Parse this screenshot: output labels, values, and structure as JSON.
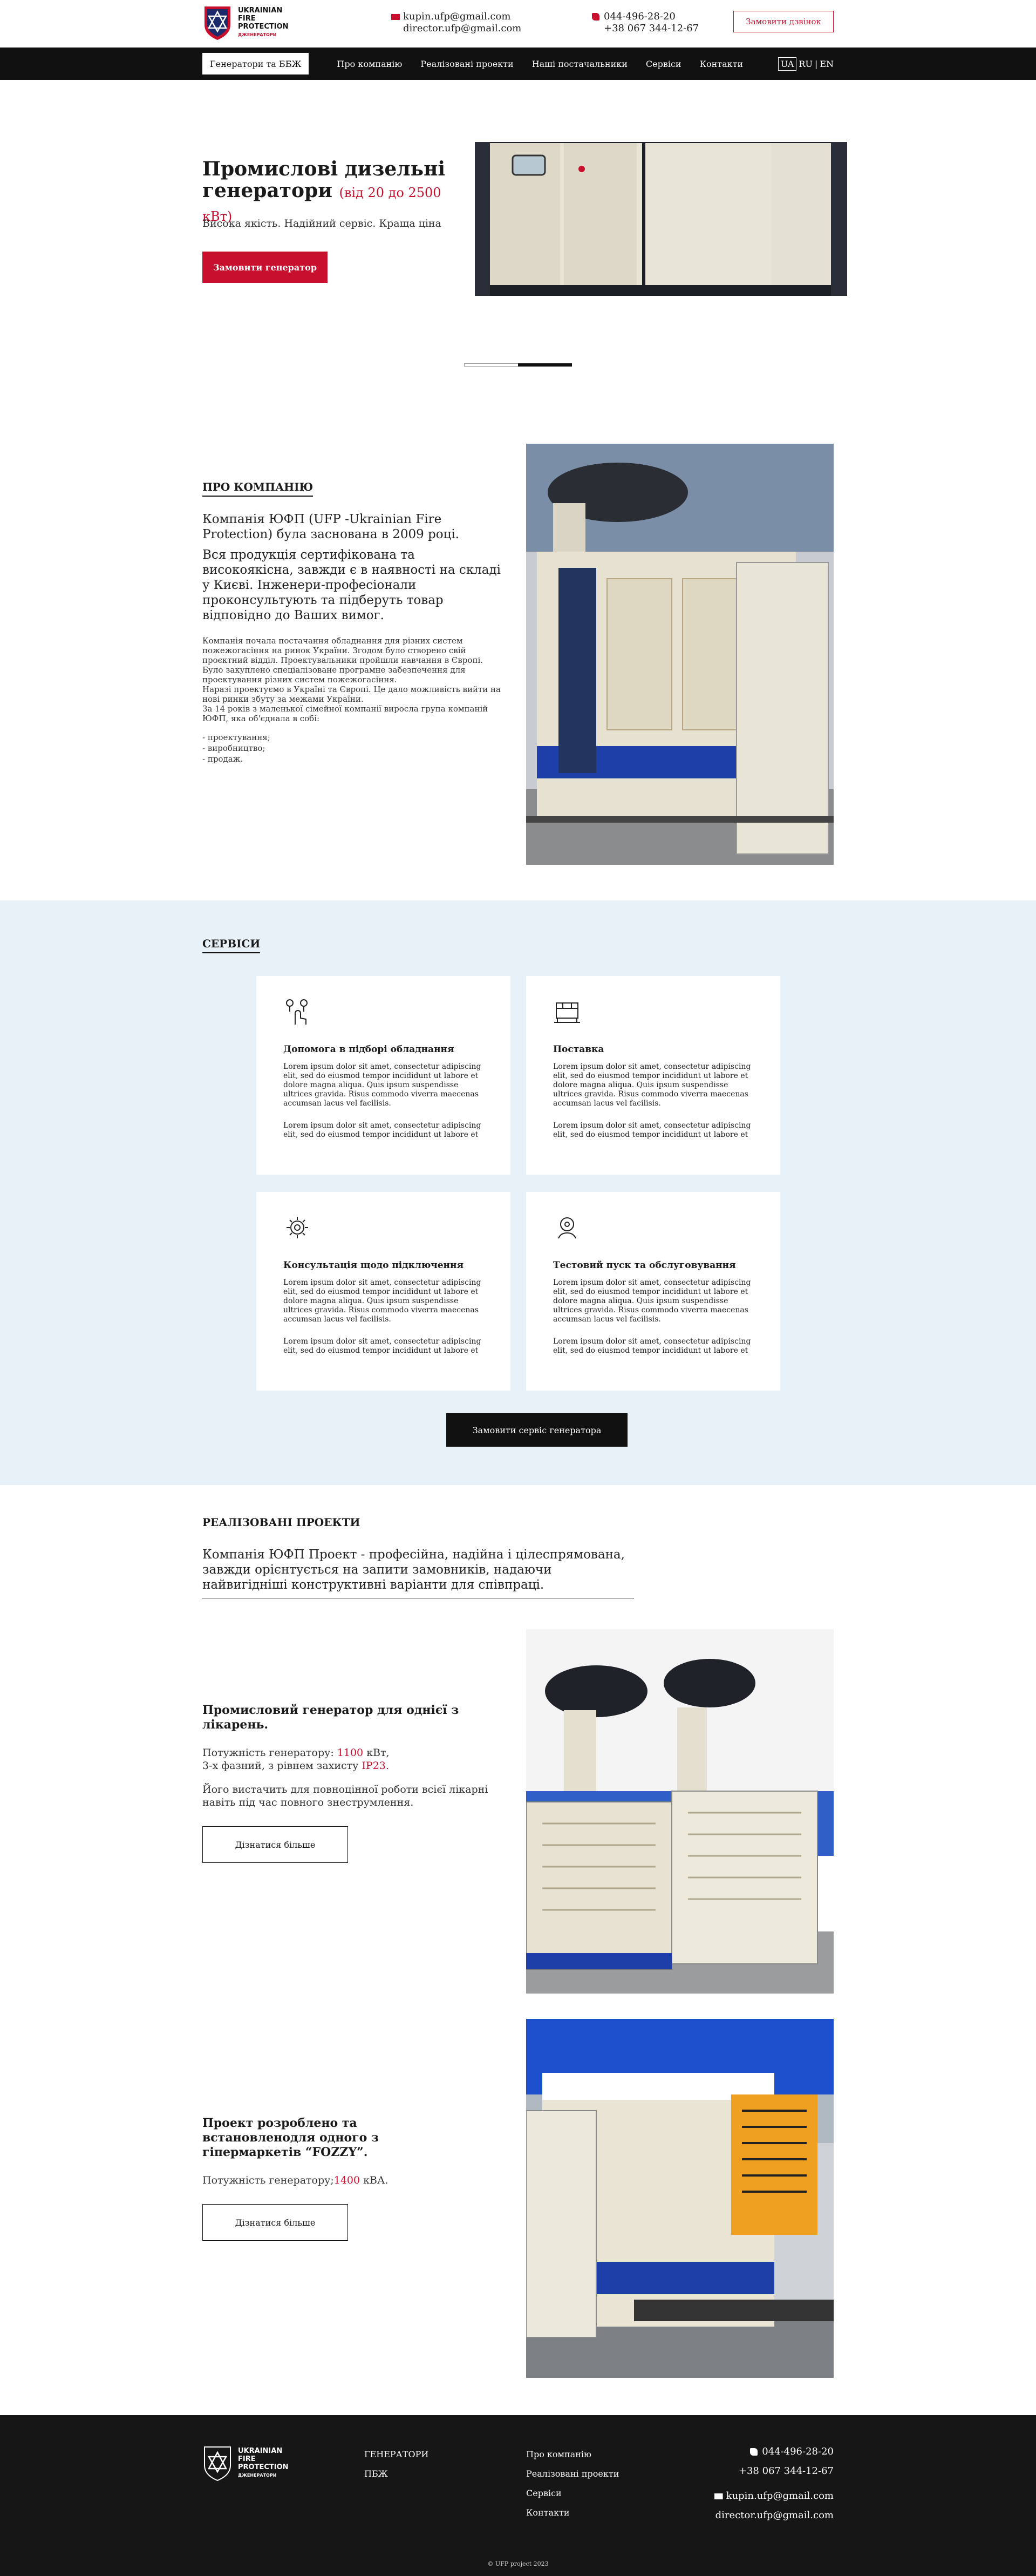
{
  "brand": {
    "name_line1": "UKRAINIAN",
    "name_line2": "FIRE",
    "name_line3": "PROTECTION",
    "name_sub": "ДЖЕНЕРАТОРИ"
  },
  "header": {
    "email1": "kupin.ufp@gmail.com",
    "email2": "director.ufp@gmail.com",
    "phone1": "044-496-28-20",
    "phone2": "+38 067 344-12-67",
    "call_button": "Замовити дзвінок"
  },
  "nav": {
    "active": "Генератори та ББЖ",
    "items": [
      "Про компанію",
      "Реалізовані проекти",
      "Наші постачальники",
      "Сервіси",
      "Контакти"
    ],
    "langs": [
      "UA",
      "RU",
      "EN"
    ],
    "lang_sep": "|"
  },
  "hero": {
    "title": "Промислові дизельні генератори",
    "range": "(від 20 до 2500 кВт)",
    "subtitle": "Висока якість. Надійний сервіс. Краща ціна",
    "cta": "Замовити генератор",
    "slide_position": 0.5
  },
  "about": {
    "label": "Про компанію",
    "lead": "Компанія ЮФП (UFP -Ukrainian Fire Protection) була заснована в 2009 році.",
    "lead2": "Вся продукція сертифікована та високоякісна, завжди є в наявності на складі у Києві. Інженери-професіонали проконсультують та підберуть товар відповідно до Ваших вимог.",
    "body": [
      "Компанія почала постачання обладнання для різних систем пожежогасіння на ринок України. Згодом було створено свій проєктний відділ. Проектувальники пройшли навчання в Європі. Було закуплено спеціалізоване програмне забезпечення для проектування різних систем пожежогасіння.",
      "Наразі проектуємо в Україні та Європі. Це дало можливість вийти на нові ринки збуту за межами України.",
      "За 14 років з маленької сімейної компанії виросла група компаній ЮФП, яка об'єднала в собі:"
    ],
    "list": [
      "- проектування;",
      "- виробництво;",
      "- продаж."
    ]
  },
  "services": {
    "label": "Сервіси",
    "cards": [
      {
        "title": "Допомога в підборі обладнання",
        "icon": "hand-selection-icon",
        "p1": "Lorem ipsum dolor sit amet, consectetur adipiscing elit, sed do eiusmod tempor incididunt ut labore et dolore magna aliqua. Quis ipsum suspendisse ultrices gravida. Risus commodo viverra maecenas accumsan lacus vel facilisis.",
        "p2": "Lorem ipsum dolor sit amet, consectetur adipiscing elit, sed do eiusmod tempor incididunt ut labore et"
      },
      {
        "title": "Поставка",
        "icon": "delivery-box-icon",
        "p1": "Lorem ipsum dolor sit amet, consectetur adipiscing elit, sed do eiusmod tempor incididunt ut labore et dolore magna aliqua. Quis ipsum suspendisse ultrices gravida. Risus commodo viverra maecenas accumsan lacus vel facilisis.",
        "p2": "Lorem ipsum dolor sit amet, consectetur adipiscing elit, sed do eiusmod tempor incididunt ut labore et"
      },
      {
        "title": "Консультація щодо підключення",
        "icon": "gear-connection-icon",
        "p1": "Lorem ipsum dolor sit amet, consectetur adipiscing elit, sed do eiusmod tempor incididunt ut labore et dolore magna aliqua. Quis ipsum suspendisse ultrices gravida. Risus commodo viverra maecenas accumsan lacus vel facilisis.",
        "p2": "Lorem ipsum dolor sit amet, consectetur adipiscing elit, sed do eiusmod tempor incididunt ut labore et"
      },
      {
        "title": "Тестовий пуск та обслуговування",
        "icon": "service-gear-icon",
        "p1": "Lorem ipsum dolor sit amet, consectetur adipiscing elit, sed do eiusmod tempor incididunt ut labore et dolore magna aliqua. Quis ipsum suspendisse ultrices gravida. Risus commodo viverra maecenas accumsan lacus vel facilisis.",
        "p2": "Lorem ipsum dolor sit amet, consectetur adipiscing elit, sed do eiusmod tempor incididunt ut labore et"
      }
    ],
    "cta": "Замовити сервіс генератора"
  },
  "projects": {
    "label": "Реалізовані проекти",
    "intro": "Компанія ЮФП Проект - професійна, надійна і цілеспрямована, завжди орієнтується на запити замовників, надаючи найвигідніші конструктивні варіанти для співпраці.",
    "items": [
      {
        "title": "Промисловий генератор для однієї з лікарень.",
        "meta_prefix": "Потужність генератору:",
        "power": "1100",
        "power_unit": "кВт,",
        "meta2_prefix": "3-х фазний, з рівнем захисту",
        "protection": "IP23.",
        "desc": "Його вистачить для повноцінної роботи всієї лікарні навіть під час повного знеструмлення.",
        "cta": "Дізнатися більше"
      },
      {
        "title": "Проект розроблено та встановленодля одного з гіпермаркетів “FOZZY”.",
        "meta_prefix": "Потужність генератору;",
        "power": "1400",
        "power_unit": "кВА.",
        "cta": "Дізнатися більше"
      }
    ]
  },
  "footer": {
    "col1": [
      "ГЕНЕРАТОРИ",
      "ПБЖ"
    ],
    "col2": [
      "Про компанію",
      "Реалізовані проекти",
      "Сервіси",
      "Контакти"
    ],
    "phone1": "044-496-28-20",
    "phone2": "+38 067 344-12-67",
    "email1": "kupin.ufp@gmail.com",
    "email2": "director.ufp@gmail.com",
    "copyright": "© UFP project 2023"
  },
  "colors": {
    "accent": "#c8102e",
    "dark": "#111111",
    "services_bg": "#e8f0f8"
  }
}
